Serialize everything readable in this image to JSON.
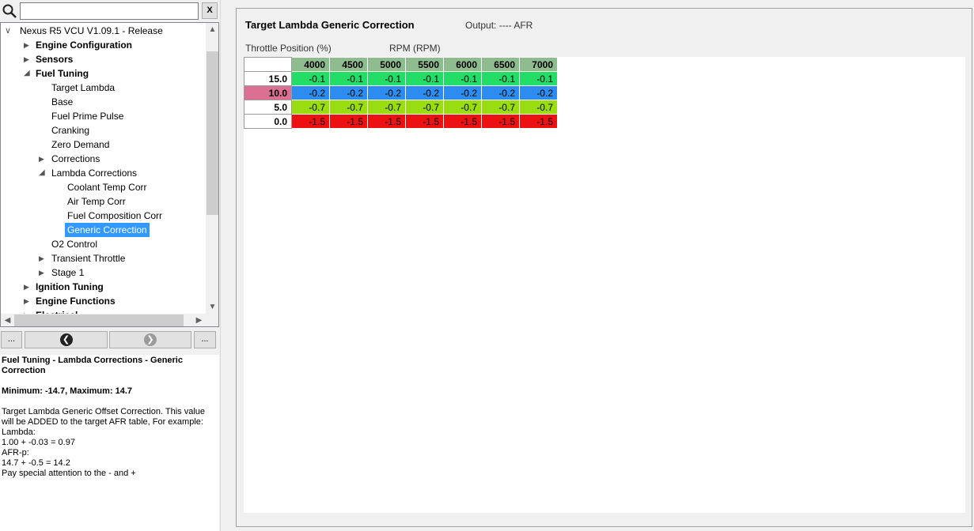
{
  "search": {
    "value": "",
    "clear_label": "X"
  },
  "tree": {
    "items": [
      {
        "label": "Nexus R5 VCU V1.09.1 - Release",
        "indent": 0,
        "arrow": "down-open",
        "bold": false,
        "selected": false
      },
      {
        "label": "Engine Configuration",
        "indent": 1,
        "arrow": "right",
        "bold": true,
        "selected": false
      },
      {
        "label": "Sensors",
        "indent": 1,
        "arrow": "right",
        "bold": true,
        "selected": false
      },
      {
        "label": "Fuel Tuning",
        "indent": 1,
        "arrow": "down",
        "bold": true,
        "selected": false
      },
      {
        "label": "Target Lambda",
        "indent": 2,
        "arrow": "none",
        "bold": false,
        "selected": false
      },
      {
        "label": "Base",
        "indent": 2,
        "arrow": "none",
        "bold": false,
        "selected": false
      },
      {
        "label": "Fuel Prime Pulse",
        "indent": 2,
        "arrow": "none",
        "bold": false,
        "selected": false
      },
      {
        "label": "Cranking",
        "indent": 2,
        "arrow": "none",
        "bold": false,
        "selected": false
      },
      {
        "label": "Zero Demand",
        "indent": 2,
        "arrow": "none",
        "bold": false,
        "selected": false
      },
      {
        "label": "Corrections",
        "indent": 2,
        "arrow": "right",
        "bold": false,
        "selected": false
      },
      {
        "label": "Lambda Corrections",
        "indent": 2,
        "arrow": "down",
        "bold": false,
        "selected": false
      },
      {
        "label": "Coolant Temp Corr",
        "indent": 3,
        "arrow": "none",
        "bold": false,
        "selected": false
      },
      {
        "label": "Air Temp Corr",
        "indent": 3,
        "arrow": "none",
        "bold": false,
        "selected": false
      },
      {
        "label": "Fuel Composition Corr",
        "indent": 3,
        "arrow": "none",
        "bold": false,
        "selected": false
      },
      {
        "label": "Generic Correction",
        "indent": 3,
        "arrow": "none",
        "bold": false,
        "selected": true
      },
      {
        "label": "O2 Control",
        "indent": 2,
        "arrow": "none",
        "bold": false,
        "selected": false
      },
      {
        "label": "Transient Throttle",
        "indent": 2,
        "arrow": "right",
        "bold": false,
        "selected": false
      },
      {
        "label": "Stage 1",
        "indent": 2,
        "arrow": "right",
        "bold": false,
        "selected": false
      },
      {
        "label": "Ignition Tuning",
        "indent": 1,
        "arrow": "right",
        "bold": true,
        "selected": false
      },
      {
        "label": "Engine Functions",
        "indent": 1,
        "arrow": "right",
        "bold": true,
        "selected": false
      },
      {
        "label": "Electrical",
        "indent": 1,
        "arrow": "right",
        "bold": true,
        "selected": false
      }
    ]
  },
  "nav": {
    "more_left": "...",
    "more_right": "..."
  },
  "description": {
    "title": "Fuel Tuning - Lambda Corrections - Generic Correction",
    "range": "Minimum: -14.7, Maximum: 14.7",
    "body": "Target Lambda Generic Offset Correction. This value will be ADDED to the target AFR table, For example:\nLambda:\n1.00 + -0.03 = 0.97\nAFR-p:\n14.7 + -0.5 = 14.2\nPay special attention to the - and +"
  },
  "table_panel": {
    "title": "Target Lambda Generic Correction",
    "output": "Output: ---- AFR",
    "y_axis_label": "Throttle Position (%)",
    "x_axis_label": "RPM (RPM)",
    "columns": [
      "4000",
      "4500",
      "5000",
      "5500",
      "6000",
      "6500",
      "7000"
    ],
    "rows": [
      {
        "label": "15.0",
        "highlight": false,
        "color": "#22dd66",
        "values": [
          "-0.1",
          "-0.1",
          "-0.1",
          "-0.1",
          "-0.1",
          "-0.1",
          "-0.1"
        ]
      },
      {
        "label": "10.0",
        "highlight": true,
        "color": "#2c8cf0",
        "values": [
          "-0.2",
          "-0.2",
          "-0.2",
          "-0.2",
          "-0.2",
          "-0.2",
          "-0.2"
        ]
      },
      {
        "label": "5.0",
        "highlight": false,
        "color": "#99dd11",
        "values": [
          "-0.7",
          "-0.7",
          "-0.7",
          "-0.7",
          "-0.7",
          "-0.7",
          "-0.7"
        ]
      },
      {
        "label": "0.0",
        "highlight": false,
        "color": "#ee1111",
        "values": [
          "-1.5",
          "-1.5",
          "-1.5",
          "-1.5",
          "-1.5",
          "-1.5",
          "-1.5"
        ]
      }
    ]
  },
  "colors": {
    "selection": "#3399ff",
    "column_header": "#8fbc8f",
    "row_highlight": "#db7093"
  }
}
